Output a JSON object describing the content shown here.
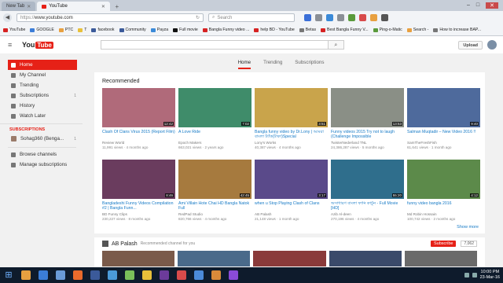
{
  "browser": {
    "tabs": [
      {
        "label": "New Tab",
        "active": false
      },
      {
        "label": "YouTube",
        "active": true
      }
    ],
    "url_proto": "https://",
    "url": "www.youtube.com",
    "search_placeholder": "Search",
    "bookmarks": [
      "YouTube",
      "GOOGLE",
      "PTC",
      "T",
      "facebook",
      "Community",
      "Payza",
      "Full movie",
      "Bangla Funny video ...",
      "help BD - YouTube",
      "Betas",
      "Best Bangla Funny V...",
      "Ping-o-Matic",
      "Search -",
      "How to increase BAP..."
    ]
  },
  "header": {
    "logo_you": "You",
    "logo_tube": "Tube",
    "upload_label": "Upload"
  },
  "sidebar": {
    "items": [
      {
        "label": "Home",
        "icon": "home-icon",
        "active": true
      },
      {
        "label": "My Channel",
        "icon": "user-icon"
      },
      {
        "label": "Trending",
        "icon": "flame-icon"
      },
      {
        "label": "Subscriptions",
        "icon": "subscriptions-icon",
        "count": "1"
      },
      {
        "label": "History",
        "icon": "history-icon"
      },
      {
        "label": "Watch Later",
        "icon": "clock-icon"
      }
    ],
    "subs_heading": "SUBSCRIPTIONS",
    "subs": [
      {
        "label": "Sohag360 (Benga...",
        "count": "1"
      }
    ],
    "bottom": [
      {
        "label": "Browse channels",
        "icon": "browse-icon"
      },
      {
        "label": "Manage subscriptions",
        "icon": "gear-icon"
      }
    ]
  },
  "subnav": {
    "home": "Home",
    "trending": "Trending",
    "subscriptions": "Subscriptions"
  },
  "recommended": {
    "title": "Recommended",
    "show_more": "Show more",
    "row1": [
      {
        "title": "Clash Of Clans Virus 2015 (Report Film)",
        "channel": "Review World",
        "meta": "11,991 views · 4 months ago",
        "dur": "12:42",
        "color": "#b06a7a"
      },
      {
        "title": "A Love Ride",
        "channel": "Epoch Makers",
        "meta": "663,021 views · 2 years ago",
        "dur": "7:02",
        "color": "#3f8c6a"
      },
      {
        "title": "Bangla funny video by Dr.Lony | আমরা বাংলা ট্যাঁক(টাকা)Special",
        "channel": "Lony's Works",
        "meta": "40,387 views · 4 months ago",
        "dur": "3:51",
        "color": "#c9a44b"
      },
      {
        "title": "Funny videos 2015 Try not to laugh (Challenge Impossible",
        "channel": "TwisterNederland TNL",
        "meta": "24,386,287 views · 5 months ago",
        "dur": "13:53",
        "color": "#8a8f86"
      },
      {
        "title": "Salman Muqtadir – New Video 2016 !!",
        "channel": "SamTheFreshFish",
        "meta": "61,641 views · 1 month ago",
        "dur": "9:40",
        "color": "#4e6a9c"
      }
    ],
    "row2": [
      {
        "title": "Bangladeshi Funny Videos Compilation #2 | Bangla Funn...",
        "channel": "BD Funny Clips",
        "meta": "230,227 views · 8 months ago",
        "dur": "8:46",
        "color": "#6a3c5e"
      },
      {
        "title": "Ami Villain Hote Chai HD Bangla Natok Full",
        "channel": "RedPad Studio",
        "meta": "820,766 views · 4 months ago",
        "dur": "42:45",
        "color": "#a67a3e"
      },
      {
        "title": "when u Stop Playing Clash of Clans",
        "channel": "AB Palash",
        "meta": "21,148 views · 1 month ago",
        "dur": "3:17",
        "color": "#5a4a8a"
      },
      {
        "title": "অসাধারণ বাংলা ফানি কার্টুন - Full Movie [HD]",
        "channel": "Azib Al-deen",
        "meta": "270,196 views · 4 months ago",
        "dur": "55:20",
        "color": "#2f6e8c"
      },
      {
        "title": "funny video bangla 2016",
        "channel": "Md Robin Hossain",
        "meta": "100,742 views · 2 months ago",
        "dur": "4:12",
        "color": "#5c8a4a"
      }
    ]
  },
  "channel": {
    "name": "AB Palash",
    "rec": "Recommended channel for you",
    "subscribe": "Subscribe",
    "count": "7,062",
    "thumb_colors": [
      "#7a5a4a",
      "#4a6a8a",
      "#8a3a3a",
      "#3a4a6a",
      "#6a6a6a"
    ]
  },
  "taskbar": {
    "time": "10:00 PM",
    "date": "23-Mar-16",
    "apps": [
      "#e8a040",
      "#3b7dd8",
      "#6a9bd8",
      "#e96a2c",
      "#3b5a9a",
      "#4b9ad8",
      "#7abf5a",
      "#e8c03a",
      "#6c3b9a",
      "#d84b4b",
      "#4b8ad8",
      "#d88a3a",
      "#8a4bd8"
    ]
  }
}
